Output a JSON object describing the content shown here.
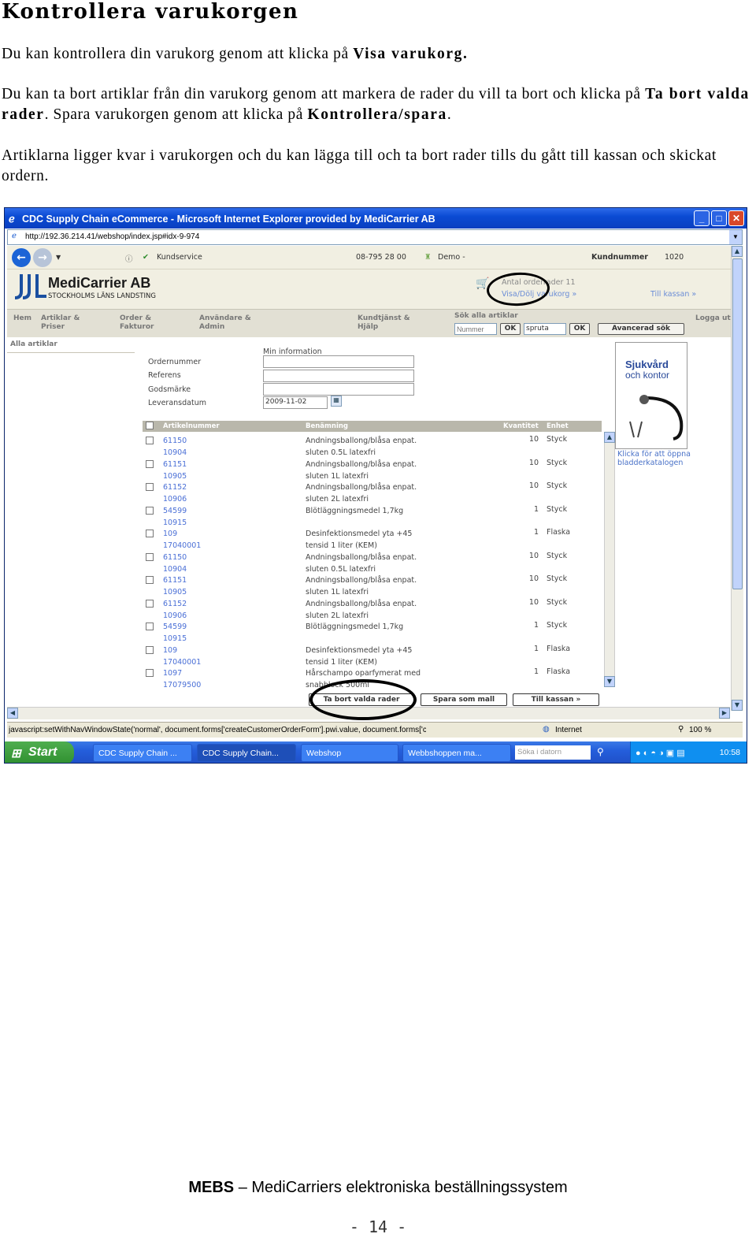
{
  "doc": {
    "title": "Kontrollera varukorgen",
    "p1_text": "Du kan kontrollera din varukorg genom att klicka på ",
    "p1_bold": "Visa varukorg.",
    "p2_a": "Du kan ta bort artiklar från din varukorg genom att markera de rader du vill ta bort och klicka på ",
    "p2_bold1": "Ta bort valda rader",
    "p2_b": ". Spara varukorgen genom att klicka på ",
    "p2_bold2": "Kontrollera/spara",
    "p2_c": ".",
    "p3": "Artiklarna ligger kvar i varukorgen och du kan lägga till och ta bort rader tills du gått till kassan och skickat ordern.",
    "footer_bold": "MEBS",
    "footer_rest": " – MediCarriers elektroniska beställningssystem",
    "page_number": "- 14 -"
  },
  "browser": {
    "title": "CDC Supply Chain eCommerce - Microsoft Internet Explorer provided by MediCarrier AB",
    "address": "http://192.36.214.41/webshop/index.jsp#idx-9-974",
    "status_text": "javascript:setWithNavWindowState('normal', document.forms['createCustomerOrderForm'].pwi.value, document.forms['c",
    "zone": "Internet",
    "zoom": "100 %"
  },
  "site": {
    "kundservice": "Kundservice",
    "phone": "08-795 28 00",
    "demo": "Demo -",
    "kundnummer_label": "Kundnummer",
    "kundnummer_value": "1020",
    "logo_name": "MediCarrier AB",
    "logo_sub": "STOCKHOLMS LÄNS LANDSTING",
    "order_rows": "Antal orderrader 11",
    "visa_dolj": "Visa/Dölj varukorg »",
    "till_kassan_top": "Till kassan »",
    "menu": {
      "hem": "Hem",
      "artiklar": "Artiklar &\nPriser",
      "order": "Order &\nFakturor",
      "anvandare": "Användare &\nAdmin",
      "kundtjanst": "Kundtjänst &\nHjälp",
      "logga_ut": "Logga ut"
    },
    "search_all_label": "Sök alla artiklar",
    "search_nummer_placeholder": "Nummer",
    "search_ok": "OK",
    "search_text": "spruta",
    "search_ok2": "OK",
    "advanced_search": "Avancerad sök",
    "alla_artiklar": "Alla artiklar",
    "min_information": "Min information",
    "labels": {
      "ordernummer": "Ordernummer",
      "referens": "Referens",
      "godsmarke": "Godsmärke",
      "leveransdatum": "Leveransdatum"
    },
    "leveransdatum_value": "2009-11-02",
    "promo_title1": "Sjukvård",
    "promo_title2": "och kontor",
    "promo_link": "Klicka för att öppna bladderkatalogen",
    "table_headers": {
      "art": "Artikelnummer",
      "ben": "Benämning",
      "qty": "Kvantitet",
      "unit": "Enhet"
    },
    "rows": [
      {
        "a1": "61150",
        "a2": "10904",
        "b1": "Andningsballong/blåsa enpat.",
        "b2": "sluten 0.5L latexfri",
        "q": "10",
        "u": "Styck"
      },
      {
        "a1": "61151",
        "a2": "10905",
        "b1": "Andningsballong/blåsa enpat.",
        "b2": "sluten 1L latexfri",
        "q": "10",
        "u": "Styck"
      },
      {
        "a1": "61152",
        "a2": "10906",
        "b1": "Andningsballong/blåsa enpat.",
        "b2": "sluten 2L latexfri",
        "q": "10",
        "u": "Styck"
      },
      {
        "a1": "54599",
        "a2": "10915",
        "b1": "Blötläggningsmedel 1,7kg",
        "b2": "",
        "q": "1",
        "u": "Styck"
      },
      {
        "a1": "109",
        "a2": "17040001",
        "b1": "Desinfektionsmedel yta +45",
        "b2": "tensid 1 liter (KEM)",
        "q": "1",
        "u": "Flaska"
      },
      {
        "a1": "61150",
        "a2": "10904",
        "b1": "Andningsballong/blåsa enpat.",
        "b2": "sluten 0.5L latexfri",
        "q": "10",
        "u": "Styck"
      },
      {
        "a1": "61151",
        "a2": "10905",
        "b1": "Andningsballong/blåsa enpat.",
        "b2": "sluten 1L latexfri",
        "q": "10",
        "u": "Styck"
      },
      {
        "a1": "61152",
        "a2": "10906",
        "b1": "Andningsballong/blåsa enpat.",
        "b2": "sluten 2L latexfri",
        "q": "10",
        "u": "Styck"
      },
      {
        "a1": "54599",
        "a2": "10915",
        "b1": "Blötläggningsmedel 1,7kg",
        "b2": "",
        "q": "1",
        "u": "Styck"
      },
      {
        "a1": "109",
        "a2": "17040001",
        "b1": "Desinfektionsmedel yta +45",
        "b2": "tensid 1 liter (KEM)",
        "q": "1",
        "u": "Flaska"
      },
      {
        "a1": "1097",
        "a2": "17079500",
        "b1": "Hårschampo oparfymerat med",
        "b2": "snabblock 500ml",
        "q": "1",
        "u": "Flaska"
      }
    ],
    "btn_remove": "Ta bort valda rader",
    "btn_save_template": "Spara som mall",
    "btn_checkout": "Till kassan »"
  },
  "taskbar": {
    "start": "Start",
    "t1": "CDC Supply Chain ...",
    "t2": "CDC Supply Chain...",
    "t3": "Webshop",
    "t4": "Webbshoppen ma...",
    "search_placeholder": "Söka i datorn",
    "clock": "10:58"
  }
}
